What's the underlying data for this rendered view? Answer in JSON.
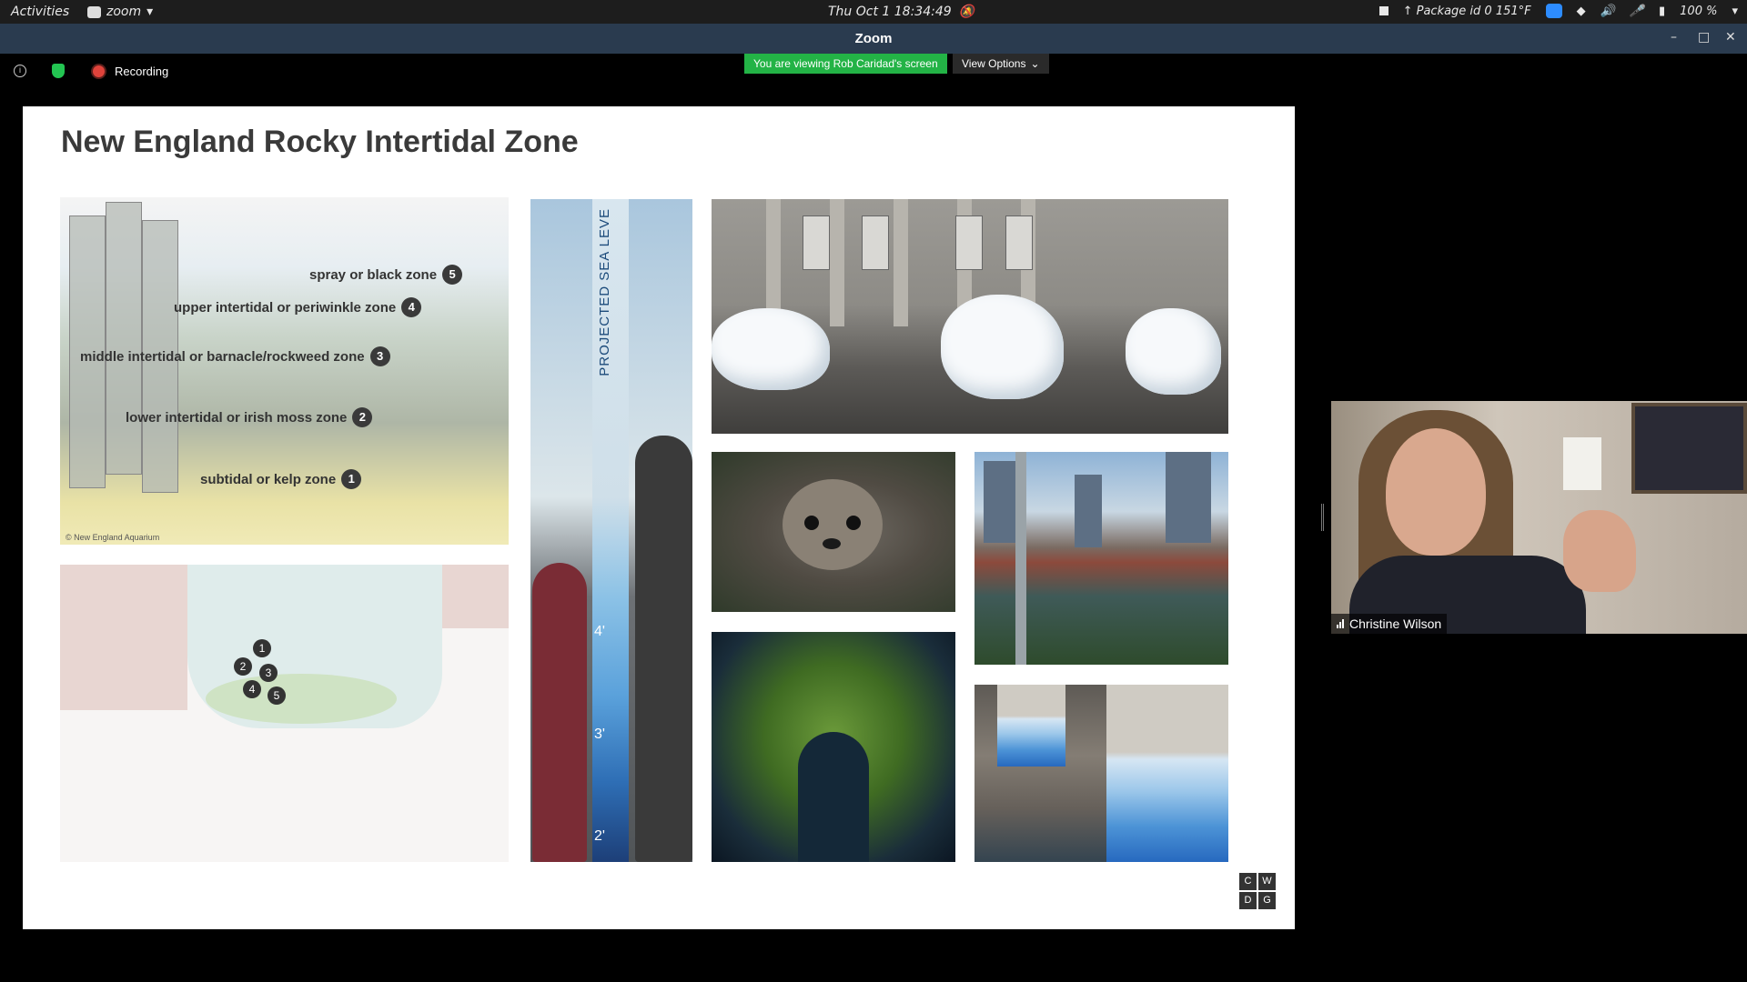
{
  "system_bar": {
    "activities": "Activities",
    "app_name": "zoom",
    "clock": "Thu Oct 1  18:34:49",
    "package_status": "↑ Package id 0 151°F",
    "battery": "100 %"
  },
  "window": {
    "title": "Zoom",
    "minimize": "–",
    "maximize": "□",
    "close": "✕"
  },
  "meeting_bar": {
    "recording_label": "Recording",
    "viewing_banner": "You are viewing Rob Caridad's screen",
    "view_options": "View Options"
  },
  "slide": {
    "title": "New England Rocky Intertidal Zone",
    "zones": [
      {
        "label": "spray or black zone",
        "num": "5"
      },
      {
        "label": "upper intertidal or periwinkle zone",
        "num": "4"
      },
      {
        "label": "middle intertidal or barnacle/rockweed zone",
        "num": "3"
      },
      {
        "label": "lower intertidal or irish moss zone",
        "num": "2"
      },
      {
        "label": "subtidal or kelp zone",
        "num": "1"
      }
    ],
    "credit": "© New England Aquarium",
    "pole_label": "PROJECTED SEA LEVE",
    "pole_marks": [
      "4'",
      "3'",
      "2'"
    ],
    "plan_numbers": [
      "1",
      "2",
      "3",
      "4",
      "5"
    ],
    "logo_letters": [
      "C",
      "W",
      "D",
      "G"
    ]
  },
  "participant": {
    "name": "Christine Wilson"
  },
  "colors": {
    "banner_green": "#23b346",
    "title_bar": "#2a3b4f",
    "record_red": "#e0433b"
  }
}
